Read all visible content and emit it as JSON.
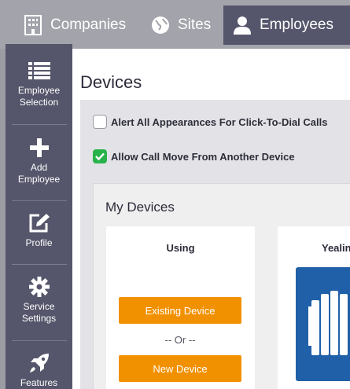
{
  "tabs": [
    {
      "label": "Companies",
      "icon": "building-icon"
    },
    {
      "label": "Sites",
      "icon": "globe-icon"
    },
    {
      "label": "Employees",
      "icon": "user-icon",
      "active": true
    }
  ],
  "sidebar": {
    "items": [
      {
        "label_line1": "Employee",
        "label_line2": "Selection",
        "icon": "list-icon"
      },
      {
        "label_line1": "Add",
        "label_line2": "Employee",
        "icon": "plus-icon"
      },
      {
        "label_line1": "Profile",
        "label_line2": "",
        "icon": "edit-icon"
      },
      {
        "label_line1": "Service",
        "label_line2": "Settings",
        "icon": "gear-icon"
      },
      {
        "label_line1": "Features",
        "label_line2": "",
        "icon": "rocket-icon"
      }
    ]
  },
  "page": {
    "title": "Devices",
    "alert_all_label": "Alert All Appearances For Click-To-Dial Calls",
    "alert_all_checked": false,
    "allow_move_label": "Allow Call Move From Another Device",
    "allow_move_checked": true
  },
  "my_devices": {
    "title": "My Devices",
    "using_card": {
      "heading": "Using",
      "existing_button": "Existing Device",
      "or_text": "-- Or --",
      "new_button": "New Device"
    },
    "second_card": {
      "heading": "Yealin"
    }
  },
  "colors": {
    "accent_orange": "#f29100",
    "check_green": "#28b34a",
    "nav_dark": "#55556b",
    "phone_blue": "#2060a8"
  }
}
